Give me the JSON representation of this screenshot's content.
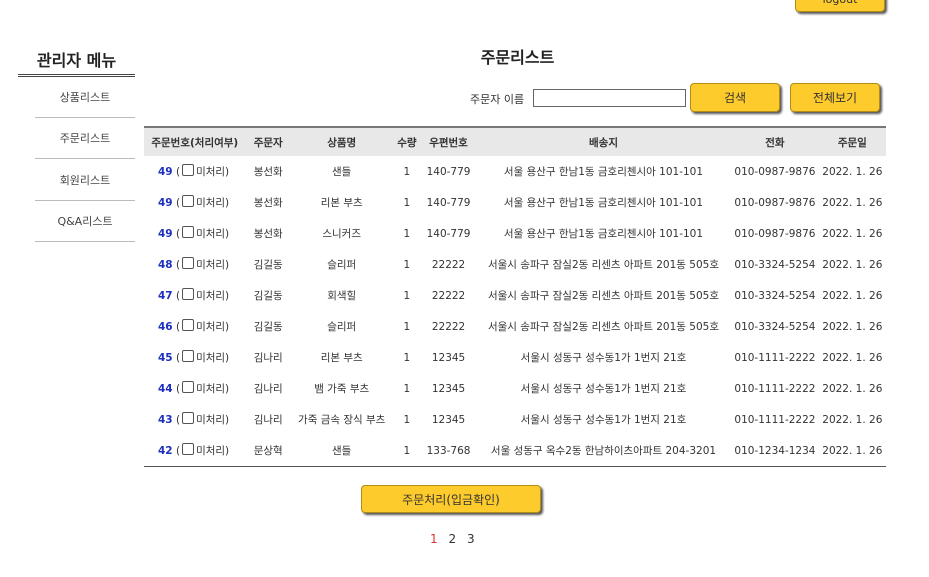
{
  "header": {
    "logout_label": "logout"
  },
  "sidebar": {
    "title": "관리자 메뉴",
    "items": [
      {
        "label": "상품리스트"
      },
      {
        "label": "주문리스트"
      },
      {
        "label": "회원리스트"
      },
      {
        "label": "Q&A리스트"
      }
    ]
  },
  "main": {
    "title": "주문리스트",
    "search": {
      "label": "주문자 이름",
      "value": "",
      "search_button": "검색",
      "view_all_button": "전체보기"
    },
    "table": {
      "columns": [
        "주문번호(처리여부)",
        "주문자",
        "상품명",
        "수량",
        "우편번호",
        "배송지",
        "전화",
        "주문일"
      ],
      "status_label": "미처리",
      "rows": [
        {
          "order_no": "49",
          "customer": "봉선화",
          "product": "샌들",
          "qty": "1",
          "zip": "140-779",
          "address": "서울 용산구 한남1동 금호리첸시아 101-101",
          "phone": "010-0987-9876",
          "date": "2022. 1. 26"
        },
        {
          "order_no": "49",
          "customer": "봉선화",
          "product": "리본 부츠",
          "qty": "1",
          "zip": "140-779",
          "address": "서울 용산구 한남1동 금호리첸시아 101-101",
          "phone": "010-0987-9876",
          "date": "2022. 1. 26"
        },
        {
          "order_no": "49",
          "customer": "봉선화",
          "product": "스니커즈",
          "qty": "1",
          "zip": "140-779",
          "address": "서울 용산구 한남1동 금호리첸시아 101-101",
          "phone": "010-0987-9876",
          "date": "2022. 1. 26"
        },
        {
          "order_no": "48",
          "customer": "김길동",
          "product": "슬리퍼",
          "qty": "1",
          "zip": "22222",
          "address": "서울시 송파구 잠실2동 리센츠 아파트 201동 505호",
          "phone": "010-3324-5254",
          "date": "2022. 1. 26"
        },
        {
          "order_no": "47",
          "customer": "김길동",
          "product": "회색힐",
          "qty": "1",
          "zip": "22222",
          "address": "서울시 송파구 잠실2동 리센츠 아파트 201동 505호",
          "phone": "010-3324-5254",
          "date": "2022. 1. 26"
        },
        {
          "order_no": "46",
          "customer": "김길동",
          "product": "슬리퍼",
          "qty": "1",
          "zip": "22222",
          "address": "서울시 송파구 잠실2동 리센츠 아파트 201동 505호",
          "phone": "010-3324-5254",
          "date": "2022. 1. 26"
        },
        {
          "order_no": "45",
          "customer": "김나리",
          "product": "리본 부츠",
          "qty": "1",
          "zip": "12345",
          "address": "서울시 성동구 성수동1가 1번지 21호",
          "phone": "010-1111-2222",
          "date": "2022. 1. 26"
        },
        {
          "order_no": "44",
          "customer": "김나리",
          "product": "뱀 가죽 부츠",
          "qty": "1",
          "zip": "12345",
          "address": "서울시 성동구 성수동1가 1번지 21호",
          "phone": "010-1111-2222",
          "date": "2022. 1. 26"
        },
        {
          "order_no": "43",
          "customer": "김나리",
          "product": "가죽 금속 장식 부츠",
          "qty": "1",
          "zip": "12345",
          "address": "서울시 성동구 성수동1가 1번지 21호",
          "phone": "010-1111-2222",
          "date": "2022. 1. 26"
        },
        {
          "order_no": "42",
          "customer": "문상혁",
          "product": "샌들",
          "qty": "1",
          "zip": "133-768",
          "address": "서울 성동구 옥수2동 한남하이츠아파트 204-3201",
          "phone": "010-1234-1234",
          "date": "2022. 1. 26"
        }
      ]
    },
    "process_button": "주문처리(입금확인)",
    "pagination": {
      "pages": [
        "1",
        "2",
        "3"
      ],
      "current": "1"
    }
  },
  "colors": {
    "button": "#fdcb2b",
    "order_no": "#1d2fbf",
    "current_page": "#dd3333",
    "header_bg": "#e8e8e8"
  }
}
